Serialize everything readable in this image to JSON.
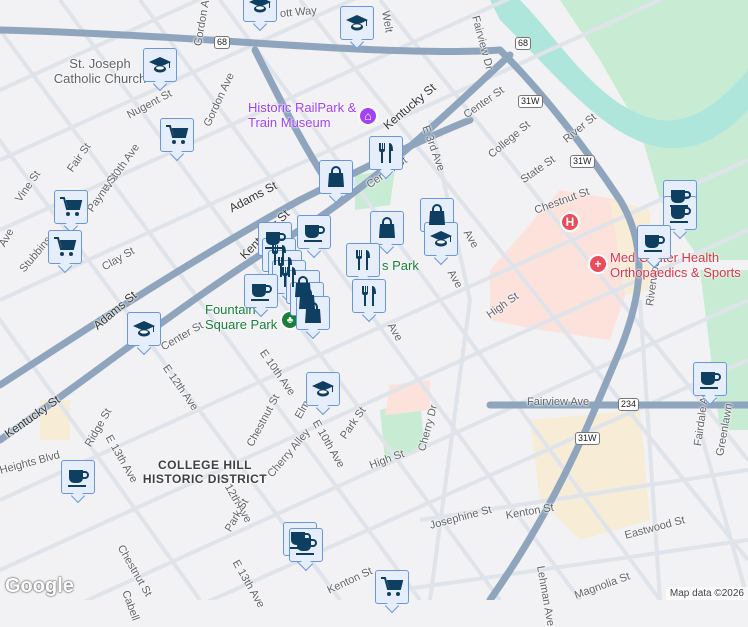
{
  "map": {
    "colors": {
      "background": "#f2f1f4",
      "highway": "#8fa5bd",
      "road": "#dfe3ea",
      "river": "#aee6dc",
      "park": "#c8ecd3",
      "hospital": "#fde2dc",
      "campus": "#f7ecd5",
      "marker_bg": "#e6eefc",
      "marker_border": "#6a97dc",
      "marker_icon": "#0e3f61",
      "poi_purple": "#a142f4",
      "poi_red": "#d93545",
      "poi_green": "#188038"
    },
    "streets": [
      "Gordon Ave",
      "Welt",
      "Fairview Dr",
      "St. Joseph Catholic Church",
      "Nugent St",
      "Gordon Ave",
      "Kentucky St",
      "E 3rd Ave",
      "Center St",
      "College St",
      "River St",
      "State St",
      "W 10th Ave",
      "Fair St",
      "Vine St",
      "Payne St",
      "Adams St",
      "Center St",
      "Chestnut St",
      "Clay St",
      "Stubbins",
      "Kentucky St",
      "Adams St",
      "Kentucky St",
      "Center St",
      "E 12th Ave",
      "E 10th Ave",
      "Chestnut St",
      "Elm St",
      "E 10th Ave",
      "Park St",
      "Cherry Alley",
      "High St",
      "Cherry Dr",
      "High St",
      "Riverwood Ave",
      "Fairdale Ave",
      "Greenlawn",
      "Fairview Ave",
      "E 13th Ave",
      "Ridge St",
      "Heights Blvd",
      "Chestnut St",
      "E 12th Ave",
      "Park St",
      "E 13th Ave",
      "Cabell",
      "Kenton St",
      "Josephine St",
      "Kenton St",
      "Eastwood St",
      "Lehman Ave",
      "Magnolia St",
      "Ave",
      "Ave",
      "Ave",
      "Ave",
      "ott Way"
    ],
    "district": "COLLEGE HILL HISTORIC DISTRICT",
    "pois": {
      "museum": "Historic RailPark & Train Museum",
      "health": "Med Center Health Orthopaedics & Sports",
      "park1": "Fountain Square Park",
      "park2": "s Park"
    },
    "route_shields": [
      "68",
      "68",
      "31W",
      "31W",
      "31W",
      "234"
    ],
    "hospital_label": "H",
    "markers": [
      "school",
      "school",
      "school",
      "shopping-cart",
      "shopping-bag",
      "restaurant",
      "shopping-cart",
      "shopping-cart",
      "shopping-bag",
      "shopping-bag",
      "school",
      "cafe",
      "restaurant",
      "cafe",
      "restaurant",
      "restaurant",
      "restaurant",
      "shopping-bag",
      "shopping-bag",
      "restaurant",
      "cafe",
      "shopping-bag",
      "school",
      "school",
      "cafe",
      "cafe",
      "cafe",
      "shopping-cart",
      "cafe",
      "cafe",
      "cafe",
      "cafe"
    ],
    "attribution": "Map data ©2026",
    "logo": "Google"
  }
}
